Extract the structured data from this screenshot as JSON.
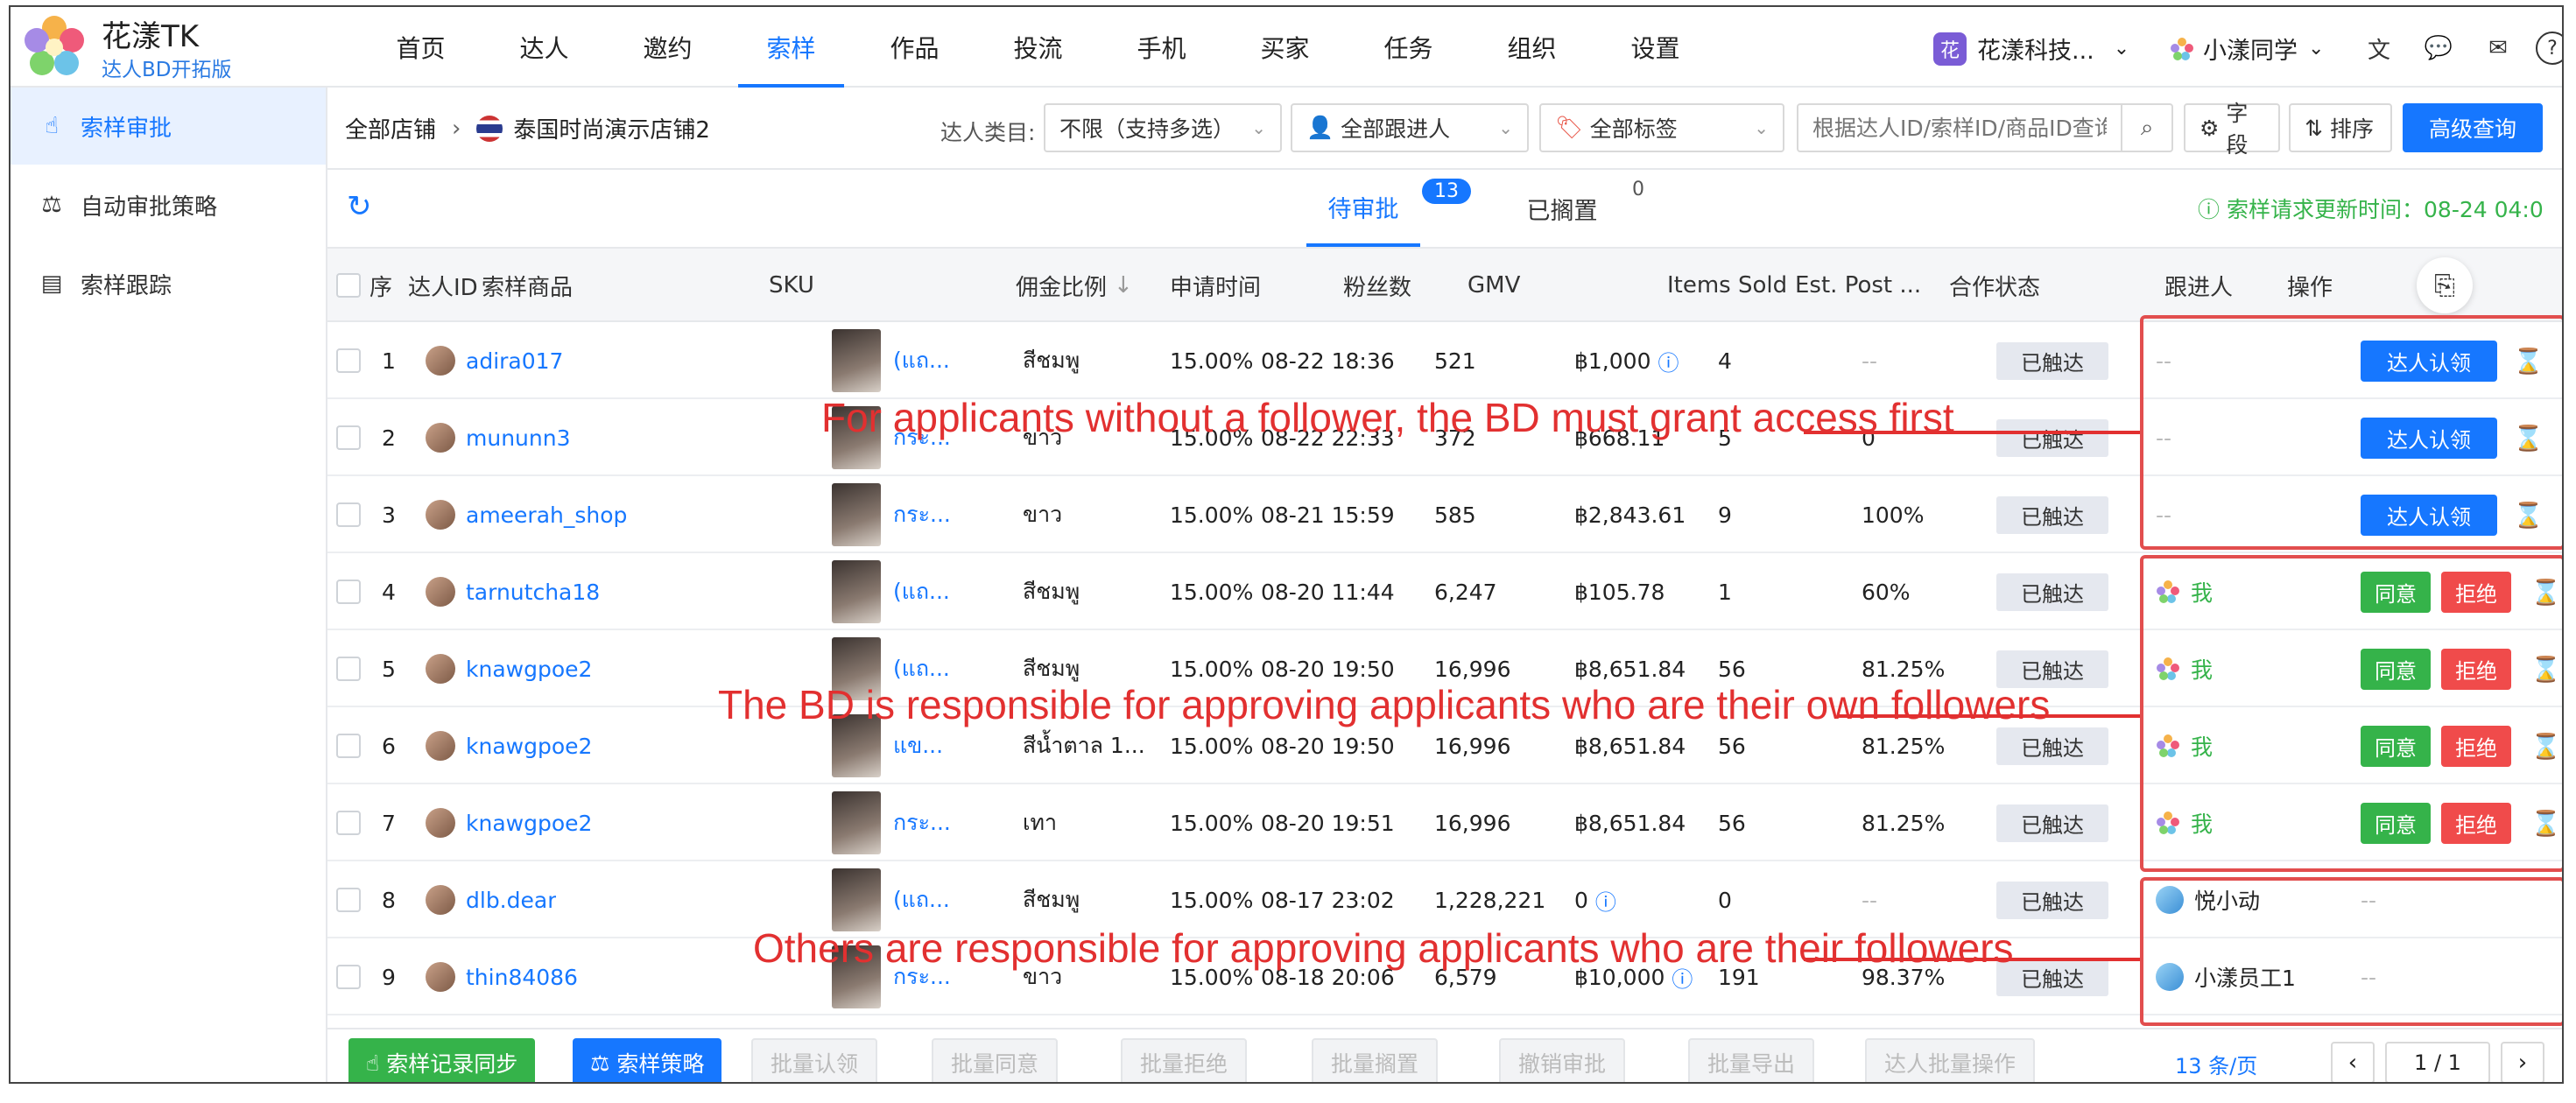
{
  "brand": {
    "name": "花漾TK",
    "sub": "达人BD开拓版"
  },
  "nav": [
    "首页",
    "达人",
    "邀约",
    "索样",
    "作品",
    "投流",
    "手机",
    "买家",
    "任务",
    "组织",
    "设置"
  ],
  "nav_active": 3,
  "enterprise": {
    "badge": "花",
    "name": "花漾科技..."
  },
  "user": {
    "name": "小漾同学"
  },
  "sidebar": [
    {
      "label": "索样审批",
      "icon": "hand-pointer-icon"
    },
    {
      "label": "自动审批策略",
      "icon": "stamp-icon"
    },
    {
      "label": "索样跟踪",
      "icon": "tracking-icon"
    }
  ],
  "filter": {
    "shop_all": "全部店铺",
    "shop_name": "泰国时尚演示店铺2",
    "type_label": "达人类目:",
    "type_value": "不限（支持多选）",
    "follower_value": "全部跟进人",
    "tag_value": "全部标签",
    "search_placeholder": "根据达人ID/索样ID/商品ID查询",
    "field_btn": "字段",
    "sort_btn": "排序",
    "advanced_btn": "高级查询"
  },
  "tabs": [
    {
      "label": "待审批",
      "count": "13"
    },
    {
      "label": "已搁置",
      "count": "0"
    }
  ],
  "update_time": "索样请求更新时间：08-24 04:0",
  "columns": [
    "序",
    "达人ID",
    "索样商品",
    "SKU",
    "佣金比例",
    "申请时间",
    "粉丝数",
    "GMV",
    "Items Sold",
    "Est. Post ...",
    "合作状态",
    "跟进人",
    "操作"
  ],
  "rows": [
    {
      "no": "1",
      "id": "adira017",
      "prod": "(แถ...",
      "sku": "สีชมพู",
      "comm": "15.00%",
      "time": "08-22 18:36",
      "fans": "521",
      "gmv": "฿1,000",
      "gmv_info": true,
      "sold": "4",
      "post": "--",
      "status": "已触达",
      "follower": "--",
      "op": "claim"
    },
    {
      "no": "2",
      "id": "mununn3",
      "prod": "กระ...",
      "sku": "ขาว",
      "comm": "15.00%",
      "time": "08-22 22:33",
      "fans": "372",
      "gmv": "฿668.11",
      "gmv_info": false,
      "sold": "5",
      "post": "0",
      "status": "已触达",
      "follower": "--",
      "op": "claim"
    },
    {
      "no": "3",
      "id": "ameerah_shop",
      "prod": "กระ...",
      "sku": "ขาว",
      "comm": "15.00%",
      "time": "08-21 15:59",
      "fans": "585",
      "gmv": "฿2,843.61",
      "gmv_info": false,
      "sold": "9",
      "post": "100%",
      "status": "已触达",
      "follower": "--",
      "op": "claim"
    },
    {
      "no": "4",
      "id": "tarnutcha18",
      "prod": "(แถ...",
      "sku": "สีชมพู",
      "comm": "15.00%",
      "time": "08-20 11:44",
      "fans": "6,247",
      "gmv": "฿105.78",
      "gmv_info": false,
      "sold": "1",
      "post": "60%",
      "status": "已触达",
      "follower": "我",
      "op": "approve"
    },
    {
      "no": "5",
      "id": "knawgpoe2",
      "prod": "(แถ...",
      "sku": "สีชมพู",
      "comm": "15.00%",
      "time": "08-20 19:50",
      "fans": "16,996",
      "gmv": "฿8,651.84",
      "gmv_info": false,
      "sold": "56",
      "post": "81.25%",
      "status": "已触达",
      "follower": "我",
      "op": "approve"
    },
    {
      "no": "6",
      "id": "knawgpoe2",
      "prod": "แข...",
      "sku": "สีน้ำตาล 1...",
      "comm": "15.00%",
      "time": "08-20 19:50",
      "fans": "16,996",
      "gmv": "฿8,651.84",
      "gmv_info": false,
      "sold": "56",
      "post": "81.25%",
      "status": "已触达",
      "follower": "我",
      "op": "approve"
    },
    {
      "no": "7",
      "id": "knawgpoe2",
      "prod": "กระ...",
      "sku": "เทา",
      "comm": "15.00%",
      "time": "08-20 19:51",
      "fans": "16,996",
      "gmv": "฿8,651.84",
      "gmv_info": false,
      "sold": "56",
      "post": "81.25%",
      "status": "已触达",
      "follower": "我",
      "op": "approve"
    },
    {
      "no": "8",
      "id": "dlb.dear",
      "prod": "(แถ...",
      "sku": "สีชมพู",
      "comm": "15.00%",
      "time": "08-17 23:02",
      "fans": "1,228,221",
      "gmv": "0",
      "gmv_info": true,
      "sold": "0",
      "post": "--",
      "status": "已触达",
      "follower": "悦小动",
      "op": "none"
    },
    {
      "no": "9",
      "id": "thin84086",
      "prod": "กระ...",
      "sku": "ขาว",
      "comm": "15.00%",
      "time": "08-18 20:06",
      "fans": "6,579",
      "gmv": "฿10,000",
      "gmv_info": true,
      "sold": "191",
      "post": "98.37%",
      "status": "已触达",
      "follower": "小漾员工1",
      "op": "none"
    }
  ],
  "op_labels": {
    "claim": "达人认领",
    "approve": "同意",
    "reject": "拒绝"
  },
  "annotations": [
    "For applicants without a follower, the BD must grant access first",
    "The BD is responsible for approving applicants who are their own followers",
    "Others are responsible for approving applicants who are their followers"
  ],
  "bottom": {
    "sync": "索样记录同步",
    "strategy": "索样策略",
    "batch_claim": "批量认领",
    "batch_approve": "批量同意",
    "batch_reject": "批量拒绝",
    "batch_shelve": "批量搁置",
    "revoke": "撤销审批",
    "batch_export": "批量导出",
    "batch_op": "达人批量操作",
    "total": "13 条/页",
    "page": "1 / 1"
  },
  "colors": {
    "primary": "#1677ff",
    "green": "#35b34a",
    "red": "#f04b4b",
    "annotation": "#e23030"
  }
}
